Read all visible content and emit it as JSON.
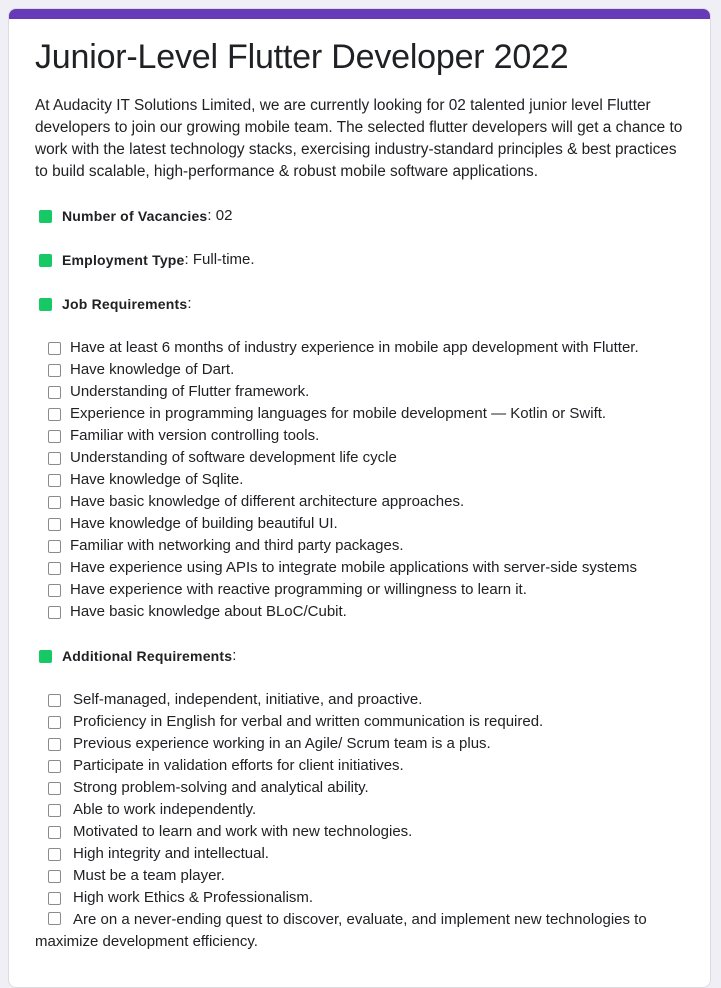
{
  "form": {
    "accent_color": "#673ab7",
    "bullet_color": "#17c964",
    "title": "Junior-Level Flutter Developer 2022",
    "intro": "At Audacity IT Solutions Limited, we are currently looking for 02 talented junior level Flutter developers to join our growing mobile team. The selected flutter developers will get a chance to work with the latest technology stacks, exercising industry-standard principles & best practices to build scalable, high-performance & robust mobile software applications.",
    "vacancies": {
      "label": "Number of Vacancies",
      "value": ": 02"
    },
    "employment": {
      "label": "Employment Type",
      "value": ": Full-time."
    },
    "job_requirements": {
      "label": "Job Requirements",
      "suffix": ":",
      "items": [
        "Have at least 6 months of industry experience in mobile app development with Flutter.",
        "Have knowledge of Dart.",
        "Understanding of Flutter framework.",
        "Experience in programming languages for mobile development — Kotlin or Swift.",
        "Familiar with version controlling tools.",
        "Understanding of software development life cycle",
        "Have knowledge of Sqlite.",
        "Have basic knowledge of different architecture approaches.",
        "Have knowledge of building beautiful UI.",
        "Familiar with networking and third party packages.",
        "Have experience using APIs to integrate mobile applications with server-side systems",
        "Have experience with reactive programming or willingness to learn it.",
        "Have basic knowledge about BLoC/Cubit."
      ]
    },
    "additional_requirements": {
      "label": "Additional Requirements",
      "suffix": ":",
      "items": [
        "Self-managed, independent, initiative, and proactive.",
        "Proficiency in English for verbal and written communication is required.",
        "Previous experience working in an Agile/ Scrum team is a plus.",
        "Participate in validation efforts for client initiatives.",
        "Strong problem-solving and analytical ability.",
        "Able to work independently.",
        "Motivated to learn and work with new technologies.",
        "High integrity and intellectual.",
        "Must be a team player.",
        "High work Ethics & Professionalism."
      ],
      "last_item_line1": "Are on a never-ending quest to discover, evaluate, and implement new technologies to",
      "last_item_line2": "maximize development efficiency."
    }
  }
}
